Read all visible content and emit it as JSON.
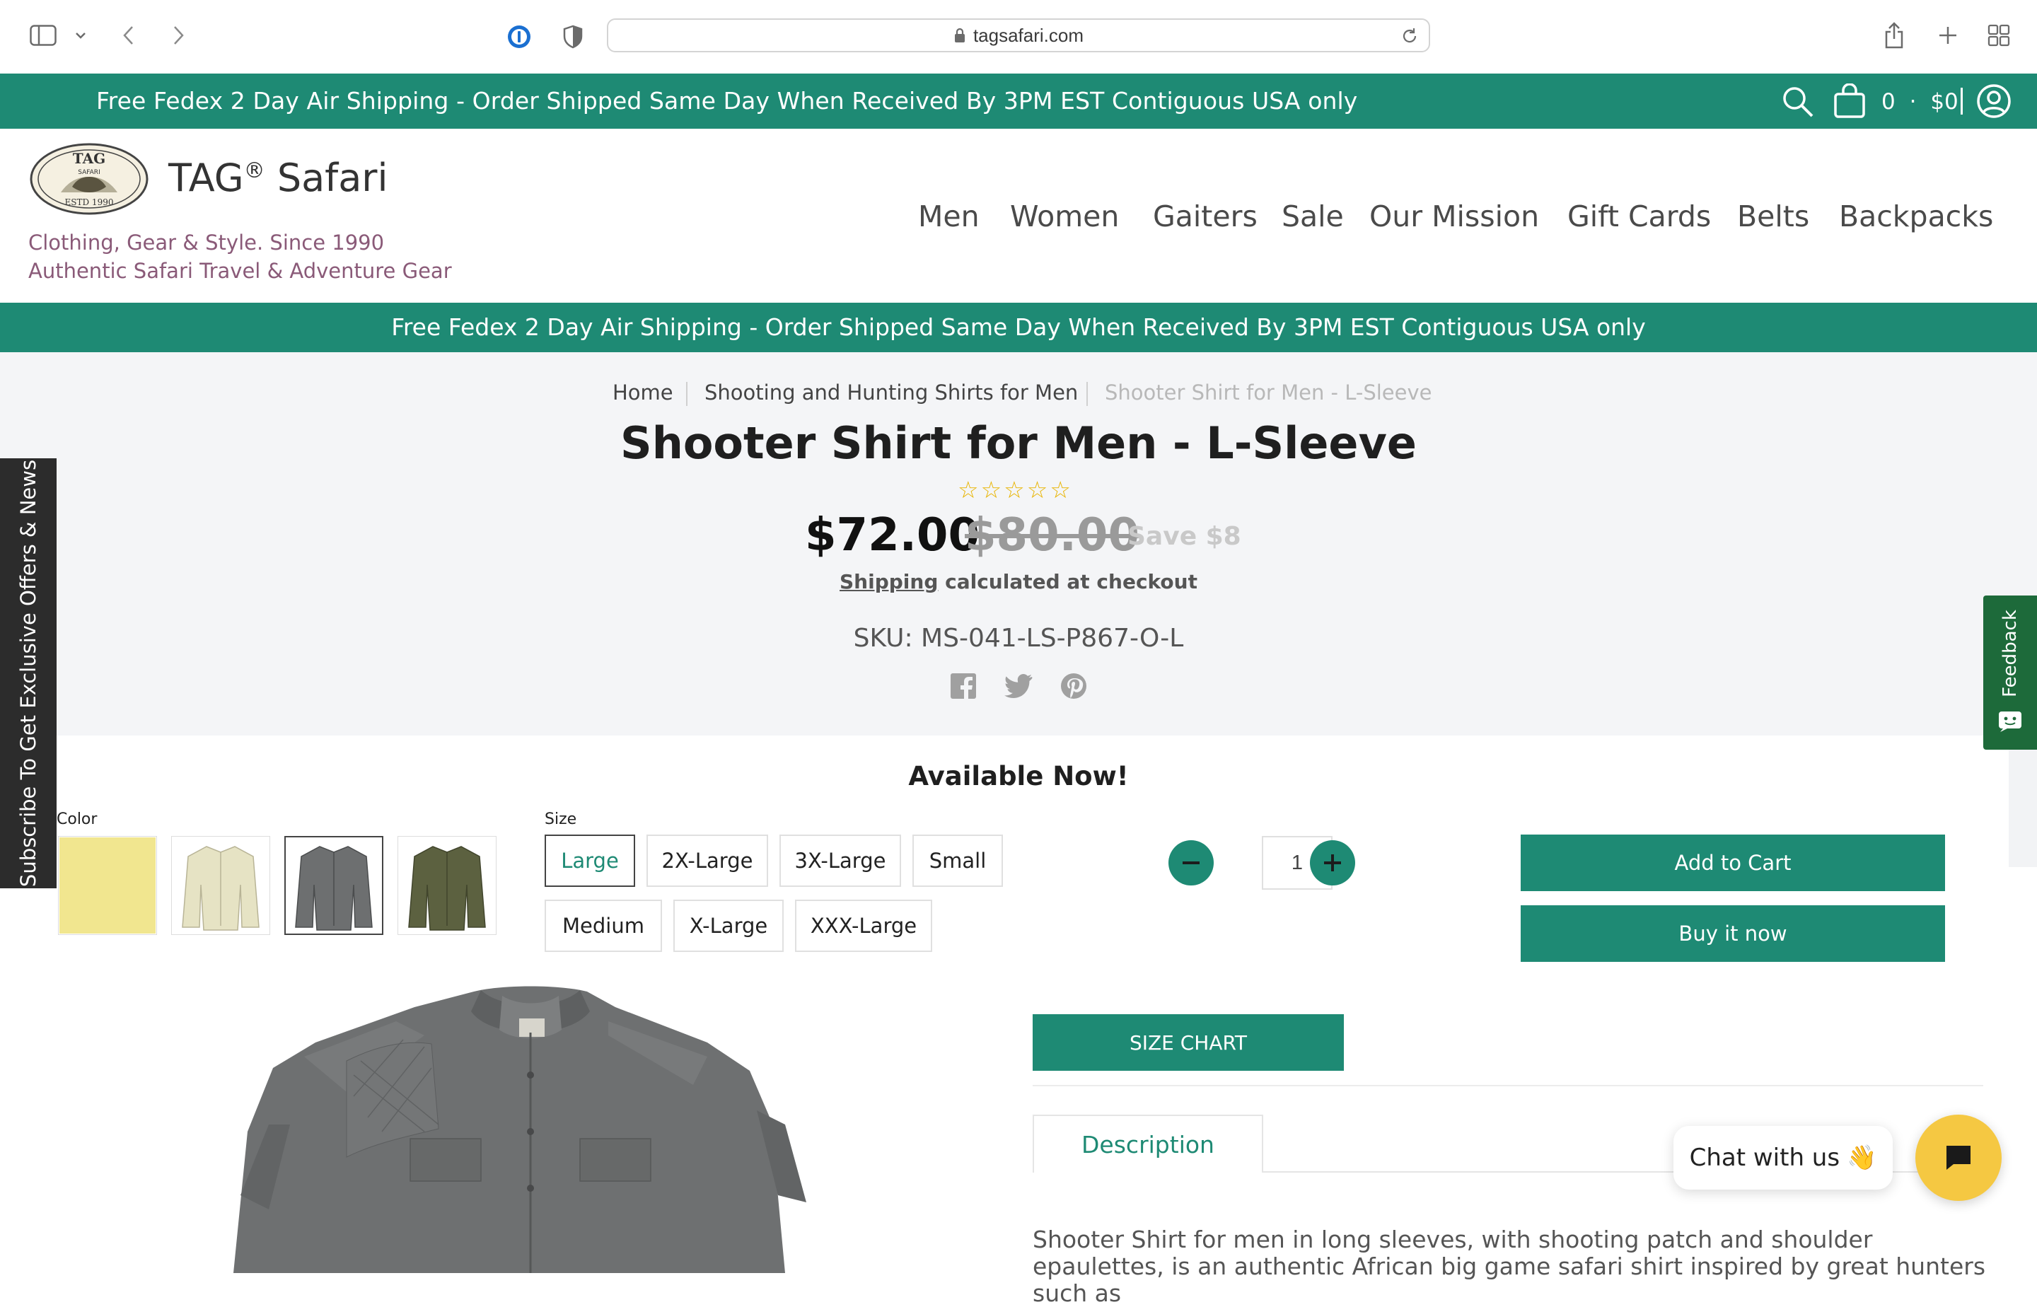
{
  "browser": {
    "url": "tagsafari.com"
  },
  "promo": {
    "top_message": "Free Fedex 2 Day Air Shipping - Order Shipped Same Day When Received By 3PM EST Contiguous USA only",
    "cart_count": "0",
    "cart_separator": "·",
    "cart_total": "$0",
    "band_message": "Free Fedex 2 Day Air Shipping - Order Shipped Same Day When Received By 3PM EST Contiguous USA only"
  },
  "brand": {
    "name": "TAG",
    "registered": "®",
    "name_suffix": "Safari",
    "tagline_1": "Clothing, Gear & Style. Since 1990",
    "tagline_2": "Authentic Safari Travel & Adventure Gear",
    "logo_text_top": "TAG",
    "logo_text_mid": "SAFARI",
    "logo_text_bottom": "ESTD 1990"
  },
  "nav": [
    "Men",
    "Women",
    "Gaiters",
    "Sale",
    "Our Mission",
    "Gift Cards",
    "Belts",
    "Backpacks"
  ],
  "breadcrumb": {
    "home": "Home",
    "category": "Shooting and Hunting Shirts for Men",
    "current": "Shooter Shirt for Men - L-Sleeve"
  },
  "product": {
    "title": "Shooter Shirt for Men - L-Sleeve",
    "stars": "☆☆☆☆☆",
    "price": "$72.00",
    "compare_price": "$80.00",
    "save": "Save $8",
    "shipping_link": "Shipping",
    "shipping_rest": " calculated at checkout",
    "sku": "SKU: MS-041-LS-P867-O-L",
    "availability": "Available Now!",
    "color_label": "Color",
    "size_label": "Size",
    "sizes": [
      "Large",
      "2X-Large",
      "3X-Large",
      "Small",
      "Medium",
      "X-Large",
      "XXX-Large"
    ],
    "selected_size": "Large",
    "quantity": "1",
    "add_to_cart": "Add to Cart",
    "buy_now": "Buy it now",
    "size_chart": "SIZE CHART",
    "tab_description": "Description",
    "description": "Shooter Shirt for men in long sleeves, with shooting patch and shoulder epaulettes, is an authentic African big game safari shirt inspired by great hunters such as",
    "swatch_colors": [
      "#f1e68f",
      "#e6e3c4",
      "#6d6f70",
      "#5c6140"
    ]
  },
  "side": {
    "subscribe": "Subscribe To Get Exclusive Offers & News",
    "feedback": "Feedback"
  },
  "chat": {
    "label": "Chat with us",
    "emoji": "👋"
  }
}
